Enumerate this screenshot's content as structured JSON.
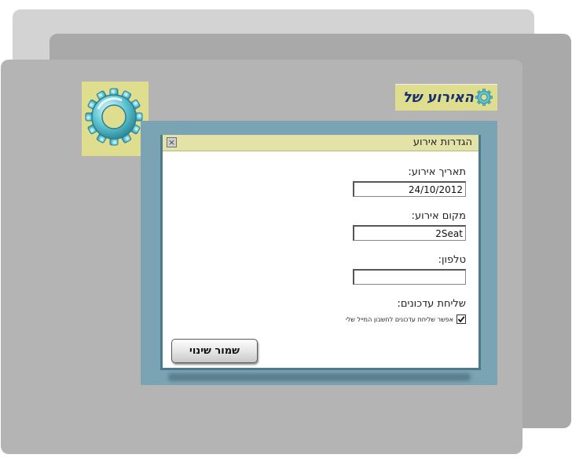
{
  "header": {
    "title": "האירוע של"
  },
  "dialog": {
    "title": "הגדרות אירוע",
    "close_label": "×"
  },
  "form": {
    "date_label": "תאריך אירוע:",
    "date_value": "24/10/2012",
    "venue_label": "מקום אירוע:",
    "venue_value": "2Seat",
    "phone_label": "טלפון:",
    "phone_value": "",
    "updates_label": "שליחת עדכונים:",
    "email_updates_label": "אפשר שליחת עדכונים לחשבון המייל שלי",
    "email_updates_checked": true,
    "save_label": "שמור שינוי"
  },
  "icons": {
    "logo": "gear-logo-icon",
    "close": "close-icon",
    "checkmark": "checkmark-icon"
  },
  "colors": {
    "accent_yellow": "#dede8e",
    "dialog_frame": "#7aa3b4",
    "title_text": "#1a2f6e",
    "gear_teal": "#3aa9b9"
  }
}
